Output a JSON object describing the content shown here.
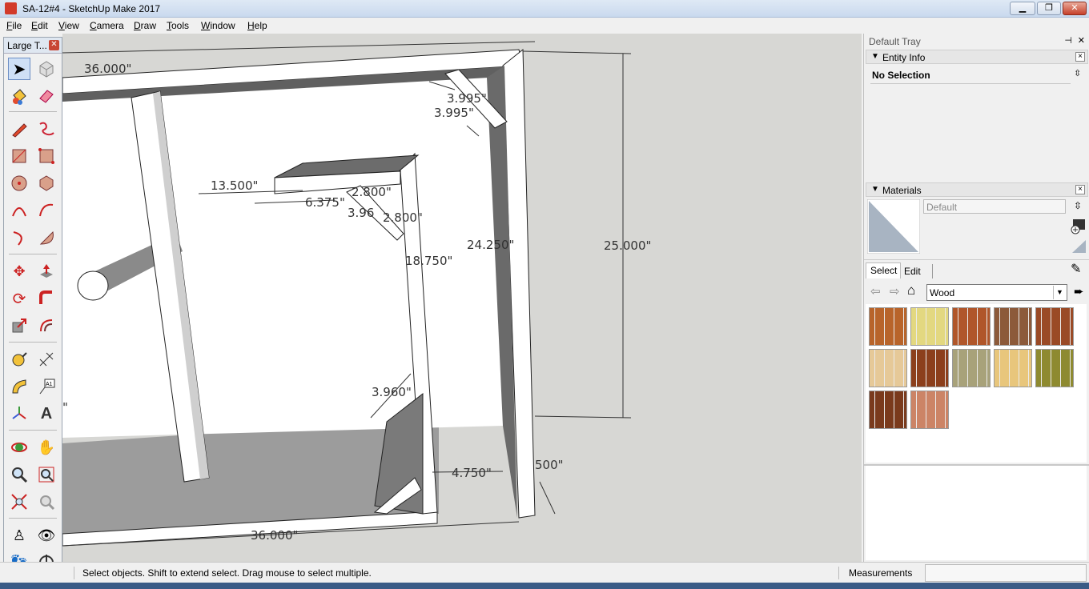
{
  "window": {
    "title": "SA-12#4 - SketchUp Make 2017",
    "minimize": "▁",
    "restore": "❐",
    "close": "✕"
  },
  "menu": [
    "File",
    "Edit",
    "View",
    "Camera",
    "Draw",
    "Tools",
    "Window",
    "Help"
  ],
  "toolbox": {
    "title": "Large T...",
    "close": "✕",
    "tools": [
      "select",
      "make-component",
      "paint-bucket",
      "eraser",
      "line",
      "freehand",
      "rectangle",
      "rotated-rectangle",
      "circle",
      "polygon",
      "arc",
      "pie",
      "two-point-arc",
      "three-point-arc",
      "move",
      "push-pull",
      "rotate",
      "follow-me",
      "scale",
      "offset",
      "tape-measure",
      "dimension",
      "protractor",
      "text",
      "axes",
      "3d-text",
      "orbit",
      "pan",
      "zoom",
      "zoom-window",
      "zoom-extents",
      "previous-view",
      "position-camera",
      "look-around",
      "walk",
      "section-plane"
    ]
  },
  "viewport": {
    "dimensions": {
      "top_width": "36.000\"",
      "bottom_width": "36.000\"",
      "left_edge": "\"",
      "brace_a": "3.995\"",
      "brace_b": "3.995\"",
      "shelf_length": "13.500\"",
      "shelf_depth": "6.375\"",
      "shelf_brace_a": "2.800\"",
      "shelf_brace_b": "2.800\"",
      "shelf_brace_c": "3.96",
      "divider_height": "18.750\"",
      "inner_height": "24.250\"",
      "outer_height": "25.000\"",
      "bottom_brace": "3.960\"",
      "gap": "4.750\"",
      "board_thickness": "500\""
    }
  },
  "tray": {
    "title": "Default Tray",
    "pin": "⊣",
    "close": "✕",
    "entity_info": {
      "label": "Entity Info",
      "selection": "No Selection"
    },
    "materials": {
      "label": "Materials",
      "current_name": "Default",
      "tab_select": "Select",
      "tab_edit": "Edit",
      "library": "Wood",
      "swatches": [
        "#b8642a",
        "#e3d880",
        "#b0562a",
        "#8c5a3a",
        "#9a4a26",
        "#e6c998",
        "#8c3f1c",
        "#a8a27a",
        "#e8c67c",
        "#8e8a30",
        "#7a3a1c",
        "#cc8466"
      ]
    }
  },
  "status": {
    "hint": "Select objects. Shift to extend select. Drag mouse to select multiple.",
    "measurements_label": "Measurements",
    "measurements_value": ""
  }
}
